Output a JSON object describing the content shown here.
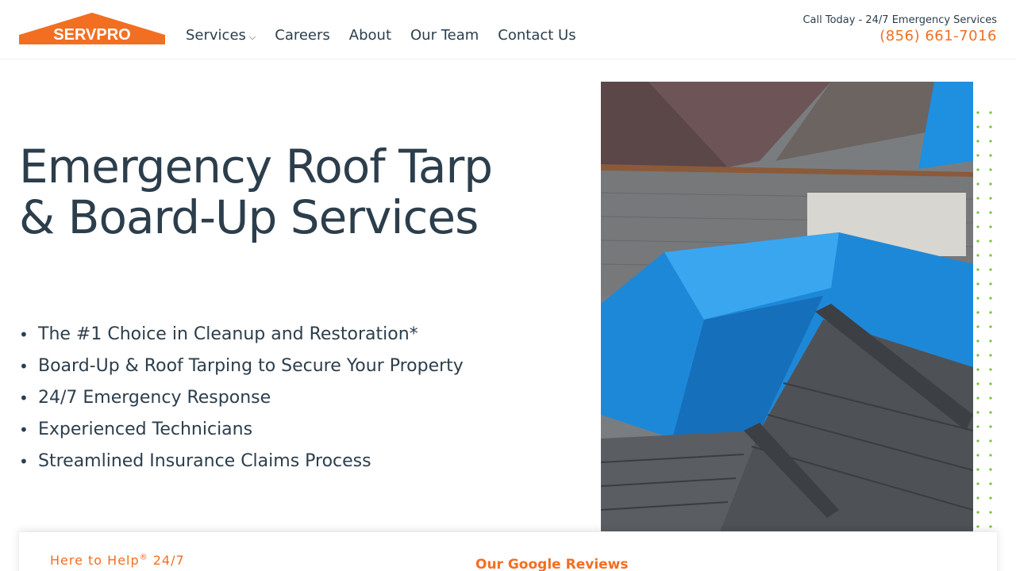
{
  "brand": {
    "logo_text": "SERVPRO",
    "accent": "#f26f21",
    "text_color": "#2c3e4c"
  },
  "nav": {
    "items": [
      {
        "label": "Services",
        "has_dropdown": true
      },
      {
        "label": "Careers"
      },
      {
        "label": "About"
      },
      {
        "label": "Our Team"
      },
      {
        "label": "Contact Us"
      }
    ]
  },
  "call": {
    "label": "Call Today - 24/7 Emergency Services",
    "phone": "(856) 661-7016"
  },
  "hero": {
    "title": "Emergency Roof Tarp & Board-Up Services",
    "bullets": [
      "The #1 Choice in Cleanup and Restoration*",
      "Board-Up & Roof Tarping to Secure Your Property",
      "24/7 Emergency Response",
      "Experienced Technicians",
      "Streamlined Insurance Claims Process"
    ],
    "image_icon": "roof-tarp-photo"
  },
  "card": {
    "left_text": "Here to Help",
    "left_sup": "®",
    "left_suffix": " 24/7",
    "reviews_title": "Our Google Reviews"
  }
}
